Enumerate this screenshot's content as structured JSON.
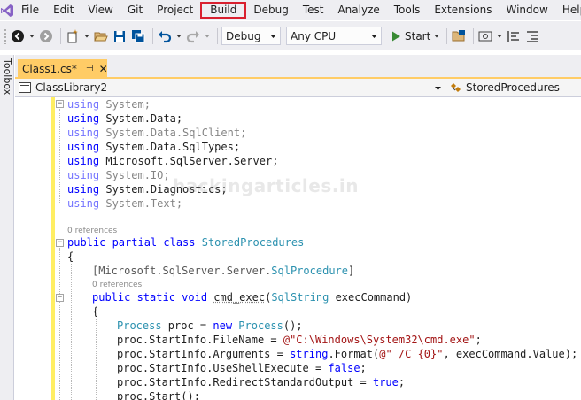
{
  "menu": [
    "File",
    "Edit",
    "View",
    "Git",
    "Project",
    "Build",
    "Debug",
    "Test",
    "Analyze",
    "Tools",
    "Extensions",
    "Window",
    "Help"
  ],
  "menu_highlight": "Build",
  "toolbar": {
    "config": "Debug",
    "platform": "Any CPU",
    "start": "Start"
  },
  "toolbox": {
    "label": "Toolbox"
  },
  "tab": {
    "title": "Class1.cs*",
    "pin": "⊣",
    "close": "✕"
  },
  "nav": {
    "project": "ClassLibrary2",
    "member": "StoredProcedures"
  },
  "code": {
    "line1": {
      "kw": "using",
      "rest": " System;"
    },
    "line2": {
      "kw": "using",
      "rest": " System.Data;"
    },
    "line3": {
      "kw": "using",
      "rest": " System.Data.SqlClient;"
    },
    "line4": {
      "kw": "using",
      "rest": " System.Data.SqlTypes;"
    },
    "line5": {
      "kw": "using",
      "rest": " Microsoft.SqlServer.Server;"
    },
    "line6": {
      "kw": "using",
      "rest": " System.IO;"
    },
    "line7": {
      "kw": "using",
      "rest": " System.Diagnostics;"
    },
    "line8": {
      "kw": "using",
      "rest": " System.Text;"
    },
    "refs1": "0 references",
    "class_kw": "public partial class",
    "class_name": "StoredProcedures",
    "brace_open": "{",
    "attr_open": "[Microsoft.SqlServer.Server.",
    "attr_type": "SqlProcedure",
    "attr_close": "]",
    "refs2": "0 references",
    "method_kw": "public static void",
    "method_name": "cmd_exec",
    "param_open": "(",
    "param_type": "SqlString",
    "param_name": " execCommand)",
    "body_open": "{",
    "l1_type": "Process",
    "l1_mid": " proc = ",
    "l1_new": "new",
    "l1_type2": "Process",
    "l1_end": "();",
    "l2_start": "proc.StartInfo.FileName = ",
    "l2_str": "@\"C:\\Windows\\System32\\cmd.exe\"",
    "l2_end": ";",
    "l3_start": "proc.StartInfo.Arguments = ",
    "l3_kw": "string",
    "l3_mid": ".Format(",
    "l3_str": "@\" /C {0}\"",
    "l3_end": ", execCommand.Value);",
    "l4_start": "proc.StartInfo.UseShellExecute = ",
    "l4_kw": "false",
    "l4_end": ";",
    "l5_start": "proc.StartInfo.RedirectStandardOutput = ",
    "l5_kw": "true",
    "l5_end": ";",
    "l6": "proc.Start();"
  },
  "watermark": "hackingarticles.in",
  "colors": {
    "keyword": "#0000ff",
    "type": "#2b91af",
    "string": "#a31515",
    "tab": "#ffcc66",
    "highlight_box": "#d9202f"
  },
  "icons": [
    "vs-logo-icon",
    "back-icon",
    "forward-icon",
    "new-item-icon",
    "open-icon",
    "save-icon",
    "save-all-icon",
    "undo-icon",
    "redo-icon",
    "start-icon",
    "find-icon",
    "screenshot-icon",
    "align-icon"
  ]
}
